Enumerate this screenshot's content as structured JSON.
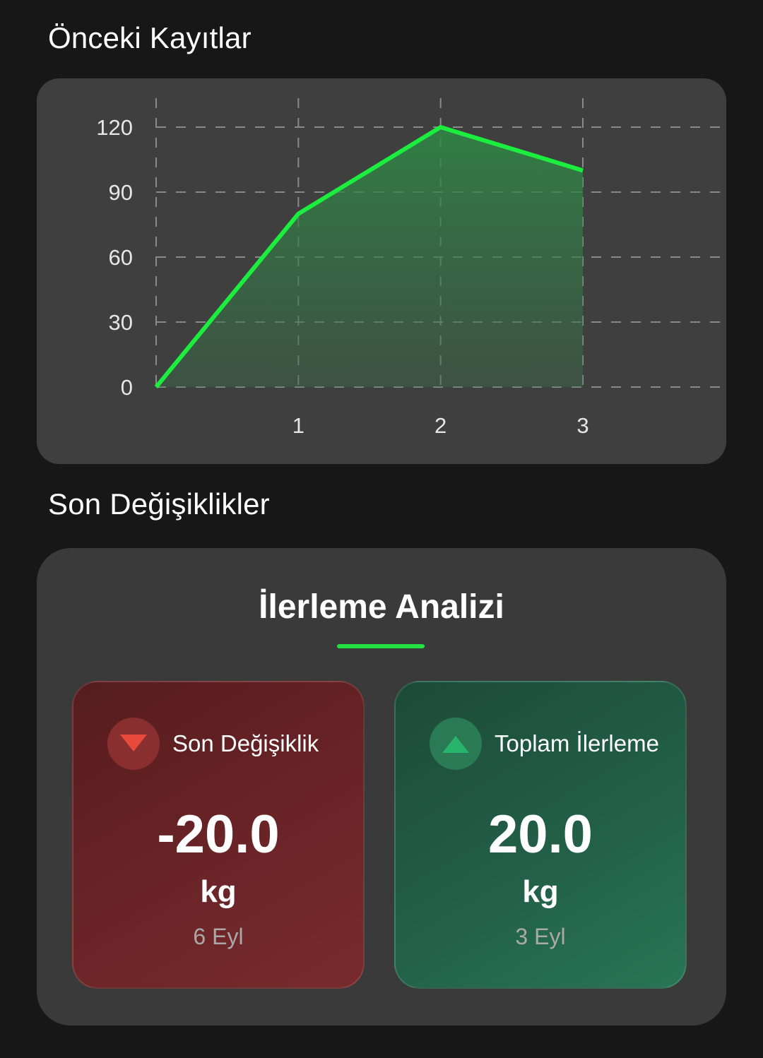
{
  "sections": {
    "records_title": "Önceki Kayıtlar",
    "changes_title": "Son Değişiklikler"
  },
  "analysis": {
    "title": "İlerleme Analizi",
    "last_change": {
      "label": "Son Değişiklik",
      "value": "-20.0",
      "unit": "kg",
      "date": "6 Eyl",
      "icon": "triangle-down-icon",
      "color": "#e84a3c"
    },
    "total_progress": {
      "label": "Toplam İlerleme",
      "value": "20.0",
      "unit": "kg",
      "date": "3 Eyl",
      "icon": "triangle-up-icon",
      "color": "#27b36a"
    }
  },
  "chart_data": {
    "type": "area",
    "x": [
      0,
      1,
      2,
      3
    ],
    "x_tick_labels": [
      "1",
      "2",
      "3"
    ],
    "y_tick_labels": [
      "0",
      "30",
      "60",
      "90",
      "120"
    ],
    "values": [
      0,
      80,
      120,
      100
    ],
    "ylim": [
      0,
      120
    ],
    "xlim": [
      0,
      3
    ],
    "grid": true,
    "line_color": "#1cee3f",
    "fill_color": "#2e8a45"
  }
}
